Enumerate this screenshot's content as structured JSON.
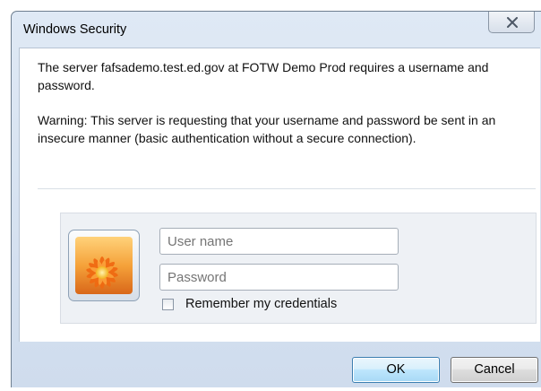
{
  "window": {
    "title": "Windows Security",
    "close_icon": "close-x-icon"
  },
  "message": {
    "line1": "The server fafsademo.test.ed.gov at FOTW Demo Prod requires a username and password.",
    "line2": "Warning: This server is requesting that your username and password be sent in an insecure manner (basic authentication without a secure connection)."
  },
  "credentials": {
    "user_tile_icon": "flower-user-picture-icon",
    "username_placeholder": "User name",
    "username_value": "",
    "password_placeholder": "Password",
    "password_value": "",
    "remember_label": "Remember my credentials",
    "remember_checked": false
  },
  "buttons": {
    "ok_label": "OK",
    "cancel_label": "Cancel"
  },
  "colors": {
    "frame": "#dfe9f5",
    "ok_border": "#3c7fb1",
    "ok_fill": "#bee6fd"
  }
}
